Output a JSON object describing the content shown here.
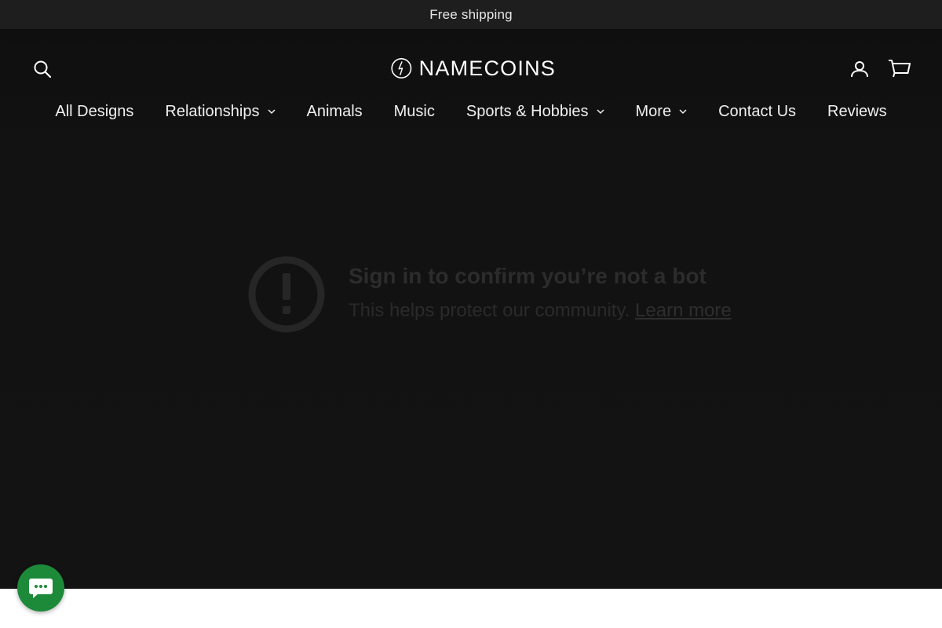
{
  "announcement": {
    "text": "Free shipping"
  },
  "header": {
    "logo_text": "NAMECOINS",
    "icons": [
      "search-icon",
      "account-icon",
      "cart-icon"
    ]
  },
  "nav": {
    "items": [
      {
        "label": "All Designs",
        "has_dropdown": false
      },
      {
        "label": "Relationships",
        "has_dropdown": true
      },
      {
        "label": "Animals",
        "has_dropdown": false
      },
      {
        "label": "Music",
        "has_dropdown": false
      },
      {
        "label": "Sports & Hobbies",
        "has_dropdown": true
      },
      {
        "label": "More",
        "has_dropdown": true
      },
      {
        "label": "Contact Us",
        "has_dropdown": false
      },
      {
        "label": "Reviews",
        "has_dropdown": false
      }
    ]
  },
  "video_message": {
    "title": "Sign in to confirm you’re not a bot",
    "subtitle": "This helps protect our community.",
    "link": "Learn more",
    "icon": "exclamation-circle-icon"
  },
  "chat": {
    "icon": "chat-bubble-icon",
    "color": "#1d8a3a"
  },
  "colors": {
    "announcement_bg": "#1e1e1e",
    "hero_bg": "#121212",
    "text": "#f0f0f0"
  }
}
